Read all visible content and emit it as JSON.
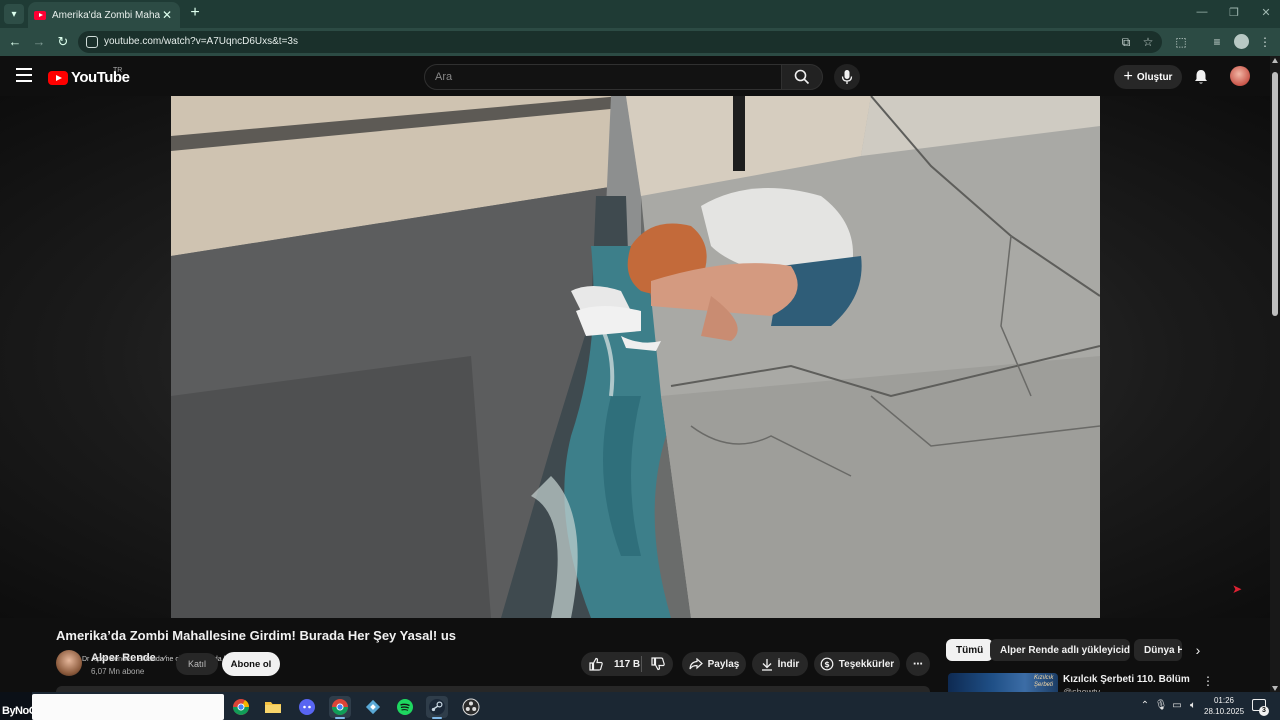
{
  "browser": {
    "tab_title": "Amerika'da Zombi Mahallesine",
    "url": "youtube.com/watch?v=A7UqncD6Uxs&t=3s"
  },
  "youtube": {
    "logo_text": "YouTube",
    "region": "TR",
    "search_placeholder": "Ara",
    "create_label": "Oluştur"
  },
  "video": {
    "title": "Amerika’da Zombi Mahallesine Girdim! Burada Her Şey Yasal! us",
    "channel_name": "Alper Rende",
    "verified_mark": "✓",
    "overlay_text": "Dr Alper Rende...   Ekranda ne okuyun burada ben",
    "subscribers": "6,07 Mn abone",
    "join_label": "Katıl",
    "subscribe_label": "Abone ol",
    "likes": "117 B",
    "share_label": "Paylaş",
    "download_label": "İndir",
    "thanks_label": "Teşekkürler",
    "more_label": "⋯"
  },
  "chips": {
    "all": "Tümü",
    "items": [
      "Alper Rende adlı yükleyiciden",
      "Dünya H"
    ]
  },
  "recommendation": {
    "title": "Kızılcık Şerbeti 110. Bölüm",
    "channel": "@showtv",
    "thumb_label": "Kızılcık Şerbeti"
  },
  "taskbar": {
    "brand": "ByNoGame",
    "time": "01:26",
    "date": "28.10.2025",
    "notification_count": "3"
  },
  "colors": {
    "accent_red": "#ff0000",
    "browser_frame": "#1f3b35",
    "page_bg": "#0f0f0f"
  }
}
